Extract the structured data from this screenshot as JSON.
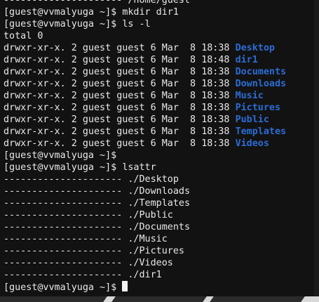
{
  "terminal": {
    "prompt": "[guest@vvmalyuga ~]$",
    "top_partial_line": "--------------------- /home/guest",
    "mkdir_command": "mkdir dir1",
    "ls_command": "ls -l",
    "total_line": "total 0",
    "listing": [
      {
        "perms": "drwxr-xr-x.",
        "links": "2",
        "owner": "guest",
        "group": "guest",
        "size": "6",
        "month": "Mar",
        "day": "8",
        "time": "18:38",
        "name": "Desktop"
      },
      {
        "perms": "drwxr-xr-x.",
        "links": "2",
        "owner": "guest",
        "group": "guest",
        "size": "6",
        "month": "Mar",
        "day": "8",
        "time": "18:48",
        "name": "dir1"
      },
      {
        "perms": "drwxr-xr-x.",
        "links": "2",
        "owner": "guest",
        "group": "guest",
        "size": "6",
        "month": "Mar",
        "day": "8",
        "time": "18:38",
        "name": "Documents"
      },
      {
        "perms": "drwxr-xr-x.",
        "links": "2",
        "owner": "guest",
        "group": "guest",
        "size": "6",
        "month": "Mar",
        "day": "8",
        "time": "18:38",
        "name": "Downloads"
      },
      {
        "perms": "drwxr-xr-x.",
        "links": "2",
        "owner": "guest",
        "group": "guest",
        "size": "6",
        "month": "Mar",
        "day": "8",
        "time": "18:38",
        "name": "Music"
      },
      {
        "perms": "drwxr-xr-x.",
        "links": "2",
        "owner": "guest",
        "group": "guest",
        "size": "6",
        "month": "Mar",
        "day": "8",
        "time": "18:38",
        "name": "Pictures"
      },
      {
        "perms": "drwxr-xr-x.",
        "links": "2",
        "owner": "guest",
        "group": "guest",
        "size": "6",
        "month": "Mar",
        "day": "8",
        "time": "18:38",
        "name": "Public"
      },
      {
        "perms": "drwxr-xr-x.",
        "links": "2",
        "owner": "guest",
        "group": "guest",
        "size": "6",
        "month": "Mar",
        "day": "8",
        "time": "18:38",
        "name": "Templates"
      },
      {
        "perms": "drwxr-xr-x.",
        "links": "2",
        "owner": "guest",
        "group": "guest",
        "size": "6",
        "month": "Mar",
        "day": "8",
        "time": "18:38",
        "name": "Videos"
      }
    ],
    "lsattr_command": "lsattr",
    "attr_flags": "---------------------",
    "lsattr_entries": [
      "./Desktop",
      "./Downloads",
      "./Templates",
      "./Public",
      "./Documents",
      "./Music",
      "./Pictures",
      "./Videos",
      "./dir1"
    ],
    "colors": {
      "background": "#121212",
      "text": "#e8e8e8",
      "directory": "#2b6cd4"
    }
  }
}
